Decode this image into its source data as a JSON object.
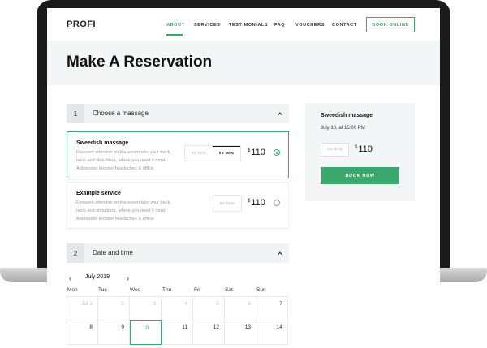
{
  "brand": {
    "logo": "PROFI",
    "accent": "#3aa76d"
  },
  "nav": {
    "items": [
      {
        "label": "ABOUT",
        "active": true
      },
      {
        "label": "SERVICES"
      },
      {
        "label": "TESTIMONIALS"
      },
      {
        "label": "FAQ"
      },
      {
        "label": "VOUCHERS"
      },
      {
        "label": "CONTACT"
      }
    ],
    "cta_label": "BOOK ONLINE"
  },
  "page": {
    "title": "Make A Reservation"
  },
  "step1": {
    "number": "1",
    "label": "Choose a massage",
    "services": [
      {
        "name": "Sweedish massage",
        "description": "Focused attention on the essentials: your back, neck and shoulders, where you need it most! Addresses tension headaches & office.",
        "durations": [
          "60 MIN",
          "90 MIN"
        ],
        "selected_duration": "90 MIN",
        "currency": "$",
        "price": "110",
        "selected": true
      },
      {
        "name": "Example service",
        "description": "Focused attention on the essentials: your back, neck and shoulders, where you need it most! Addresses tension headaches & office.",
        "durations": [
          "60 MIN"
        ],
        "currency": "$",
        "price": "110",
        "selected": false
      }
    ]
  },
  "step2": {
    "number": "2",
    "label": "Date and time",
    "month": "July 2019",
    "weekdays": [
      "Mon",
      "Tue",
      "Wed",
      "Thu",
      "Fri",
      "Sat",
      "Sun"
    ],
    "weeks": [
      [
        "Jul 1",
        "2",
        "3",
        "4",
        "5",
        "6",
        "7"
      ],
      [
        "8",
        "9",
        "10",
        "11",
        "12",
        "13",
        "14"
      ]
    ],
    "today": "10"
  },
  "summary": {
    "title": "Sweedish massage",
    "datetime": "July 10, at 15:00 PM",
    "duration": "60 MIN",
    "currency": "$",
    "price": "110",
    "button_label": "BOOK NOW"
  },
  "icons": {
    "collapse": "chevron-up-icon",
    "prev": "chevron-left-icon",
    "next": "chevron-right-icon"
  }
}
